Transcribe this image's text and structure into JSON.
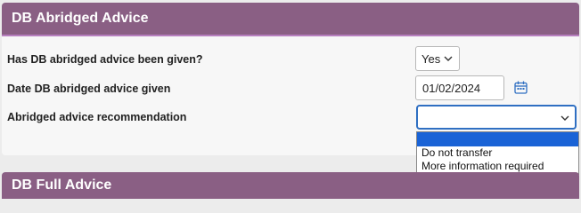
{
  "section": {
    "title": "DB Abridged Advice"
  },
  "fields": [
    {
      "label": "Has DB abridged advice been given?",
      "value": "Yes"
    },
    {
      "label": "Date DB abridged advice given",
      "value": "01/02/2024"
    },
    {
      "label": "Abridged advice recommendation",
      "value": ""
    }
  ],
  "dropdown": {
    "options": [
      "",
      "Do not transfer",
      "More information required"
    ]
  },
  "next_section": {
    "title": "DB Full Advice"
  },
  "icons": {
    "chevron": "chevron-down-icon",
    "calendar": "calendar-icon"
  },
  "colors": {
    "header": "#8a5f84",
    "header_border": "#b77fbf",
    "focus": "#2f6fc2",
    "highlight": "#1a63d6"
  }
}
